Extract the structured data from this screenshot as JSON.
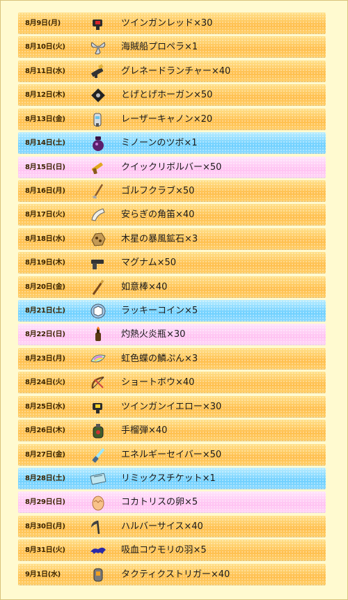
{
  "rows": [
    {
      "date": "8月9日(月)",
      "item": "ツインガンレッド×30",
      "kind": "weekday",
      "icon": "twin-gun-red-icon"
    },
    {
      "date": "8月10日(火)",
      "item": "海賊船プロペラ×1",
      "kind": "weekday",
      "icon": "propeller-icon"
    },
    {
      "date": "8月11日(水)",
      "item": "グレネードランチャー×40",
      "kind": "weekday",
      "icon": "grenade-launcher-icon"
    },
    {
      "date": "8月12日(木)",
      "item": "とげとげホーガン×50",
      "kind": "weekday",
      "icon": "spiky-bowgun-icon"
    },
    {
      "date": "8月13日(金)",
      "item": "レーザーキャノン×20",
      "kind": "weekday",
      "icon": "laser-cannon-icon"
    },
    {
      "date": "8月14日(土)",
      "item": "ミノーンのツボ×1",
      "kind": "sat",
      "icon": "pot-icon"
    },
    {
      "date": "8月15日(日)",
      "item": "クイックリボルバー×50",
      "kind": "sun",
      "icon": "revolver-icon"
    },
    {
      "date": "8月16日(月)",
      "item": "ゴルフクラブ×50",
      "kind": "weekday",
      "icon": "golf-club-icon"
    },
    {
      "date": "8月17日(火)",
      "item": "安らぎの角笛×40",
      "kind": "weekday",
      "icon": "horn-icon"
    },
    {
      "date": "8月18日(水)",
      "item": "木星の暴風鉱石×3",
      "kind": "weekday",
      "icon": "ore-icon"
    },
    {
      "date": "8月19日(木)",
      "item": "マグナム×50",
      "kind": "weekday",
      "icon": "magnum-icon"
    },
    {
      "date": "8月20日(金)",
      "item": "如意棒×40",
      "kind": "weekday",
      "icon": "staff-icon"
    },
    {
      "date": "8月21日(土)",
      "item": "ラッキーコイン×5",
      "kind": "sat",
      "icon": "coin-icon"
    },
    {
      "date": "8月22日(日)",
      "item": "灼熱火炎瓶×30",
      "kind": "sun",
      "icon": "fire-bottle-icon"
    },
    {
      "date": "8月23日(月)",
      "item": "虹色蝶の鱗ぷん×3",
      "kind": "weekday",
      "icon": "rainbow-scale-icon"
    },
    {
      "date": "8月24日(火)",
      "item": "ショートボウ×40",
      "kind": "weekday",
      "icon": "short-bow-icon"
    },
    {
      "date": "8月25日(水)",
      "item": "ツインガンイエロー×30",
      "kind": "weekday",
      "icon": "twin-gun-yellow-icon"
    },
    {
      "date": "8月26日(木)",
      "item": "手榴弾×40",
      "kind": "weekday",
      "icon": "hand-grenade-icon"
    },
    {
      "date": "8月27日(金)",
      "item": "エネルギーセイバー×50",
      "kind": "weekday",
      "icon": "energy-saber-icon"
    },
    {
      "date": "8月28日(土)",
      "item": "リミックスチケット×1",
      "kind": "sat",
      "icon": "ticket-icon"
    },
    {
      "date": "8月29日(日)",
      "item": "コカトリスの卵×5",
      "kind": "sun",
      "icon": "egg-icon"
    },
    {
      "date": "8月30日(月)",
      "item": "ハルバーサイス×40",
      "kind": "weekday",
      "icon": "scythe-icon"
    },
    {
      "date": "8月31日(火)",
      "item": "吸血コウモリの羽×5",
      "kind": "weekday",
      "icon": "bat-wing-icon"
    },
    {
      "date": "9月1日(水)",
      "item": "タクティクストリガー×40",
      "kind": "weekday",
      "icon": "tactics-trigger-icon"
    }
  ]
}
